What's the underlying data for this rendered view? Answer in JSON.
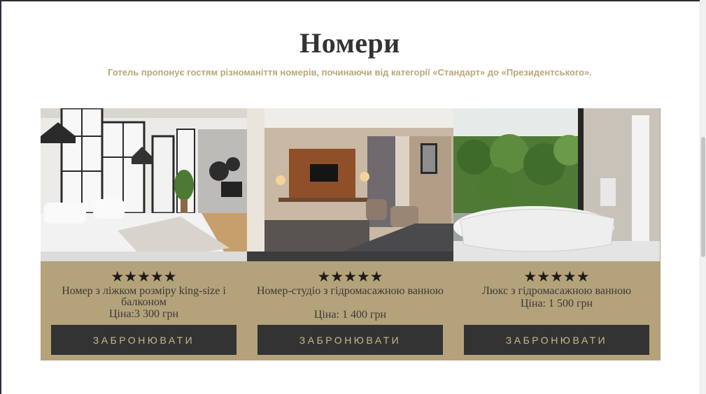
{
  "section": {
    "title": "Номери",
    "subtitle": "Готель пропонує гостям різноманіття номерів, починаючи від категорії «Стандарт» до «Президентського»."
  },
  "colors": {
    "card_background": "#b4a27a",
    "button_background": "#333333",
    "button_text": "#c8b88e",
    "subtitle": "#b9a77a"
  },
  "rooms": [
    {
      "image_icon": "bedroom-photo",
      "rating": 5,
      "stars": "★★★★★",
      "name": "Номер з ліжком розміру king-size і балконом",
      "price": "Ціна:3 300 грн",
      "button_label": "ЗАБРОНЮВАТИ"
    },
    {
      "image_icon": "studio-room-photo",
      "rating": 5,
      "stars": "★★★★★",
      "name": "Номер-студіо з гідромасажною ванною",
      "price": "Ціна: 1 400 грн",
      "button_label": "ЗАБРОНЮВАТИ"
    },
    {
      "image_icon": "bathtub-photo",
      "rating": 5,
      "stars": "★★★★★",
      "name": "Люкс з гідромасажною ванною",
      "price": "Ціна: 1 500 грн",
      "button_label": "ЗАБРОНЮВАТИ"
    }
  ]
}
